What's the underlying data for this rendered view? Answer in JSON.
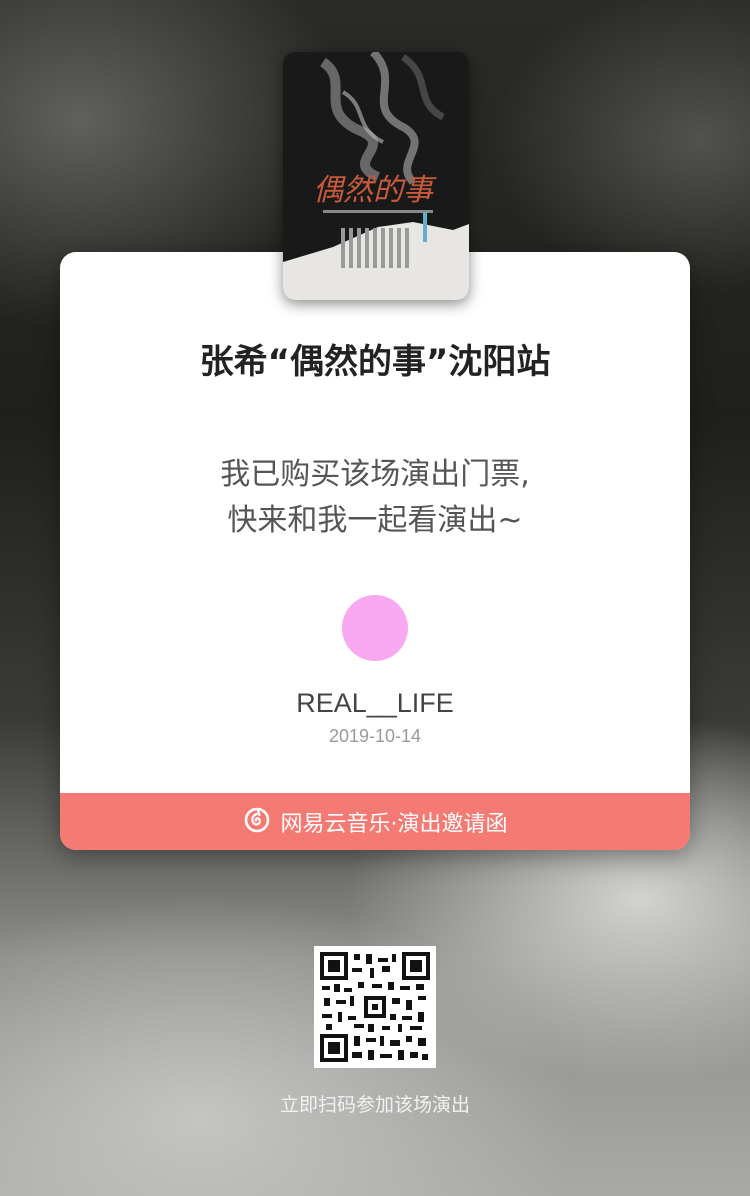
{
  "event": {
    "title": "张希“偶然的事”沈阳站",
    "message_line1": "我已购买该场演出门票,",
    "message_line2": "快来和我一起看演出~"
  },
  "user": {
    "name": "REAL__LIFE",
    "date": "2019-10-14",
    "avatar_color": "#f7a8f1"
  },
  "banner": {
    "label": "网易云音乐·演出邀请函",
    "icon": "netease-music-icon",
    "color": "#f57a73"
  },
  "qr": {
    "caption": "立即扫码参加该场演出",
    "icon": "qr-code"
  },
  "poster": {
    "art_text": "偶然的事"
  }
}
